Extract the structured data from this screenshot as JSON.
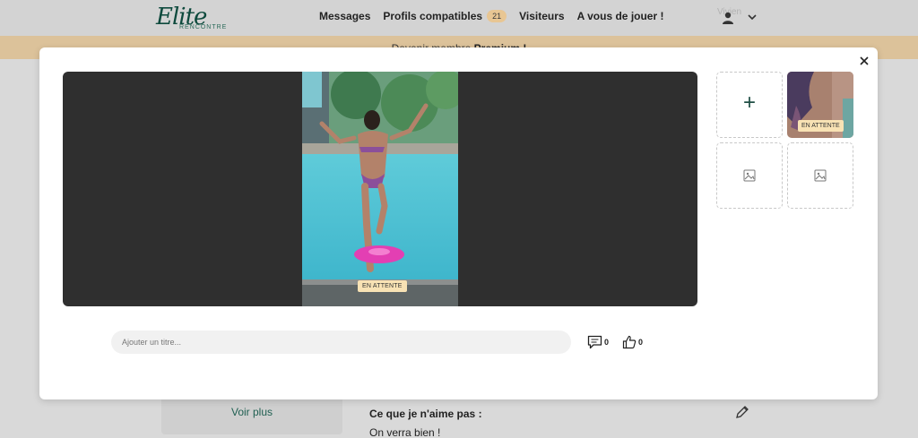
{
  "header": {
    "logo_main": "Elite",
    "logo_sub": "RENCONTRE",
    "nav": {
      "messages": "Messages",
      "profils": "Profils compatibles",
      "profils_count": "21",
      "visiteurs": "Visiteurs",
      "jouer": "A vous de jouer !"
    },
    "user_name": "Vivien"
  },
  "banner": {
    "prefix": "Devenir membre",
    "bold": "Premium !"
  },
  "modal": {
    "main_photo_status": "EN ATTENTE",
    "thumb_status": "EN ATTENTE",
    "add_label": "+",
    "title_placeholder": "Ajouter un titre...",
    "comments_count": "0",
    "likes_count": "0"
  },
  "background_page": {
    "voir_plus": "Voir plus",
    "dislike_heading": "Ce que je n'aime pas :",
    "dislike_text": "On verra bien !"
  },
  "colors": {
    "brand": "#0e4a3d",
    "badge": "#e8c693",
    "status": "#f8e2b4",
    "banner": "#dcc29a"
  }
}
